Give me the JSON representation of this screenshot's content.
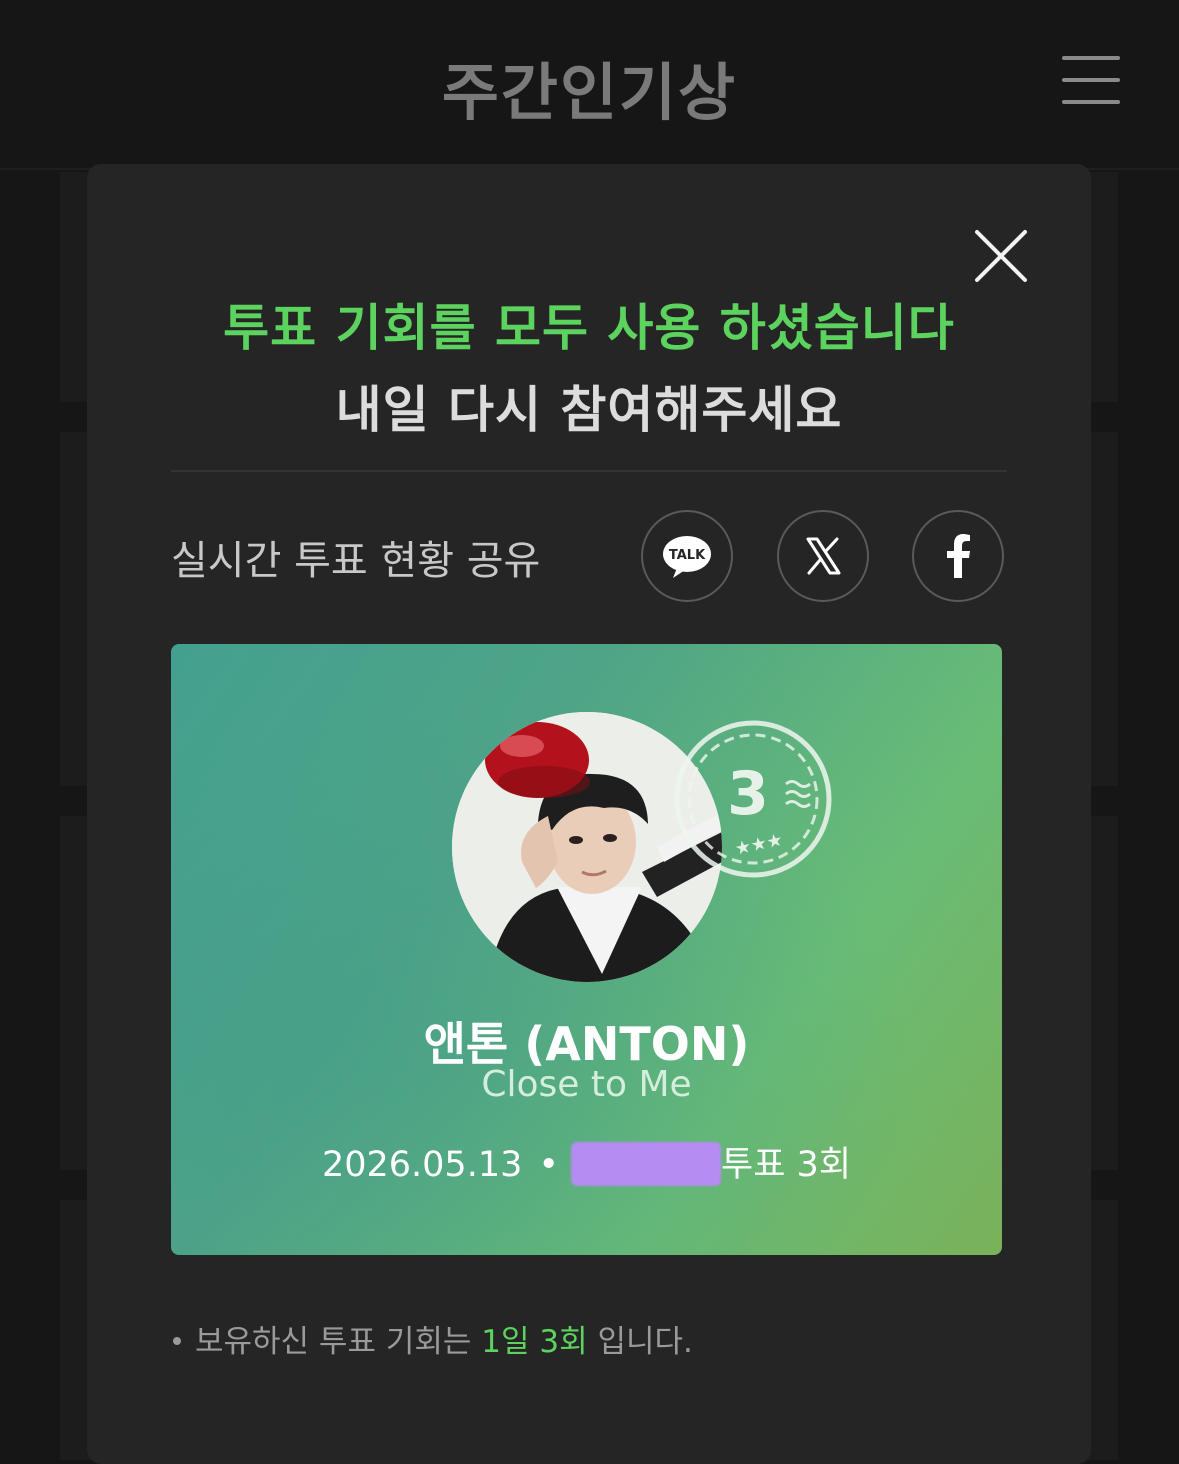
{
  "header": {
    "title": "주간인기상",
    "menu_icon": "hamburger-menu-icon"
  },
  "modal": {
    "close_icon": "close-icon",
    "headline_green": "투표 기회를 모두 사용 하셨습니다",
    "headline_white": "내일 다시 참여해주세요",
    "share": {
      "label": "실시간 투표 현황 공유",
      "buttons": [
        {
          "name": "kakao-talk",
          "icon": "kakaotalk-icon",
          "text": "TALK"
        },
        {
          "name": "x",
          "icon": "x-logo-icon"
        },
        {
          "name": "facebook",
          "icon": "facebook-icon"
        }
      ]
    },
    "vote_card": {
      "artist": "앤톤 (ANTON)",
      "song": "Close to Me",
      "date": "2026.05.13",
      "separator": "•",
      "vote_text": "투표 3회",
      "stamp_number": "3",
      "stamp_stars": "★★★"
    },
    "notice": {
      "prefix": "보유하신 투표 기회는 ",
      "highlight": "1일 3회",
      "suffix": " 입니다."
    }
  },
  "colors": {
    "accent_green": "#5cd35e",
    "background": "#161616",
    "modal_bg": "#252525",
    "redaction": "#b58cf2"
  }
}
